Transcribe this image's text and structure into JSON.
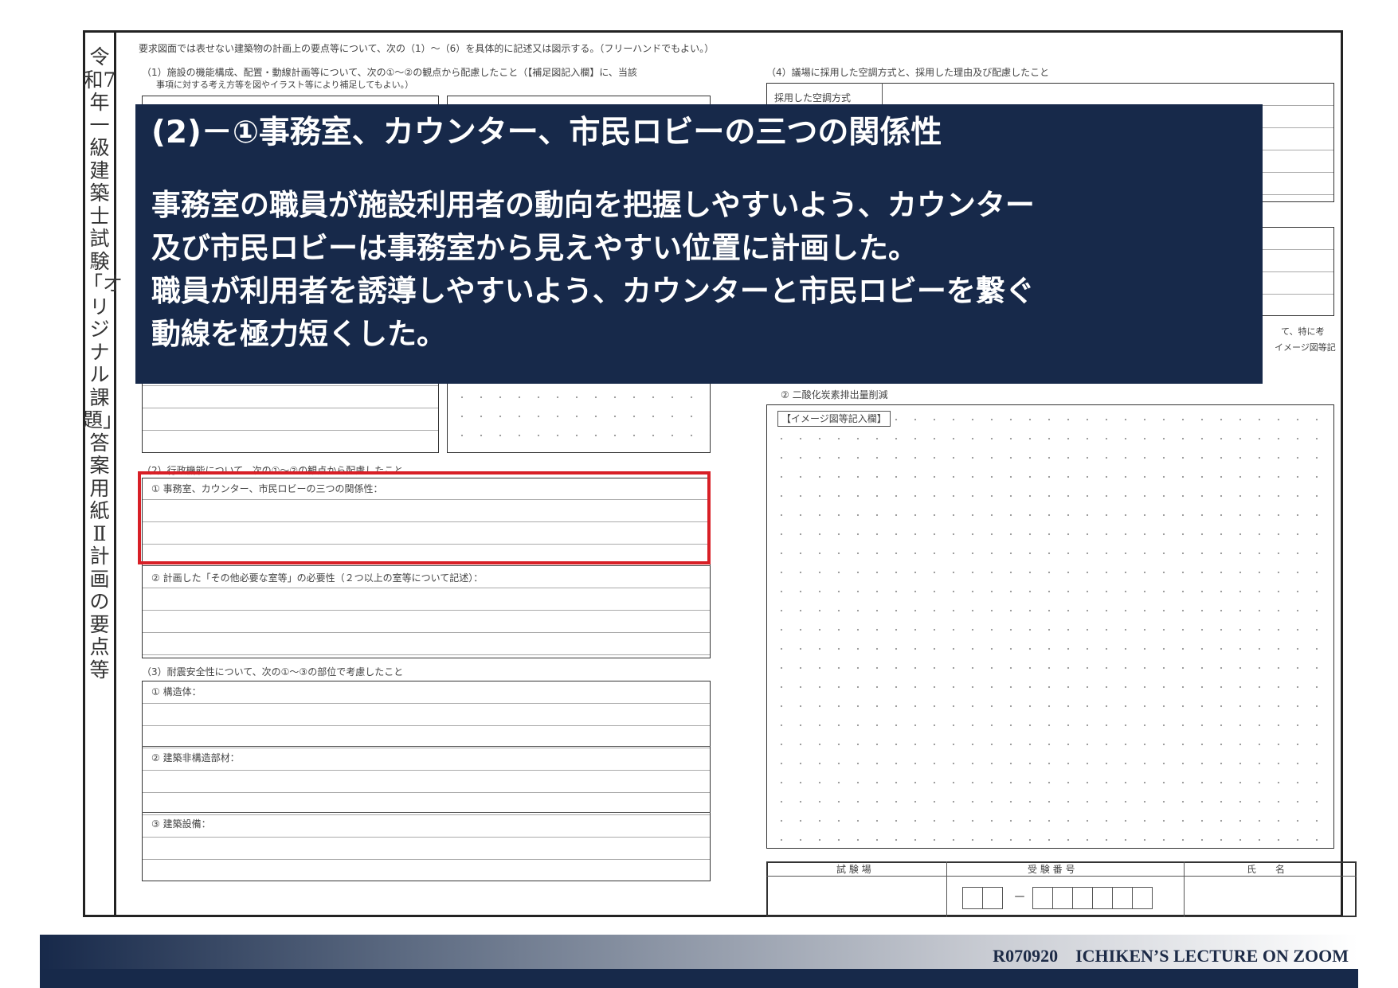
{
  "sheet": {
    "vertical_title": "令和7年 一級建築士試験「オリジナル課題」 答 案 用 紙 Ⅱ 計画の要点等",
    "instruction": "要求図面では表せない建築物の計画上の要点等について、次の（1）～（6）を具体的に記述又は図示する。（フリーハンドでもよい。）",
    "q1_a": "（1）施設の機能構成、配置・動線計画等について、次の①～②の観点から配慮したこと（【補足図記入欄】に、当該",
    "q1_b": "事項に対する考え方等を図やイラスト等により補足してもよい。）",
    "q4": "（4）議場に採用した空調方式と、採用した理由及び配慮したこと",
    "q4_label": "採用した空調方式",
    "q5_fragment_a": "て、特に考",
    "q5_fragment_b": "イメージ図等記",
    "q6_2": "② 二酸化炭素排出量削減",
    "image_box_label": "【イメージ図等記入欄】",
    "q2": "（2）行政機能について、次の①～②の観点から配慮したこと",
    "q2_1": "① 事務室、カウンター、市民ロビーの三つの関係性：",
    "q2_2": "② 計画した「その他必要な室等」の必要性（２つ以上の室等について記述）：",
    "q3": "（3）耐震安全性について、次の①～③の部位で考慮したこと",
    "q3_1": "① 構造体：",
    "q3_2": "② 建築非構造部材：",
    "q3_3": "③ 建築設備：",
    "footer_table": {
      "col1": "試 験 場",
      "col2": "受 験 番 号",
      "col3": "氏　　名",
      "dash": "－"
    }
  },
  "overlay": {
    "title": "(2)－①事務室、カウンター、市民ロビーの三つの関係性",
    "lines": [
      "事務室の職員が施設利用者の動向を把握しやすいよう、カウンター",
      "及び市民ロビーは事務室から見えやすい位置に計画した。",
      "職員が利用者を誘導しやすいよう、カウンターと市民ロビーを繋ぐ",
      "動線を極力短くした。"
    ],
    "background": "#17294a",
    "highlight_color": "#d81f26"
  },
  "footer": {
    "text": "R070920　ICHIKEN’S LECTURE ON ZOOM"
  }
}
